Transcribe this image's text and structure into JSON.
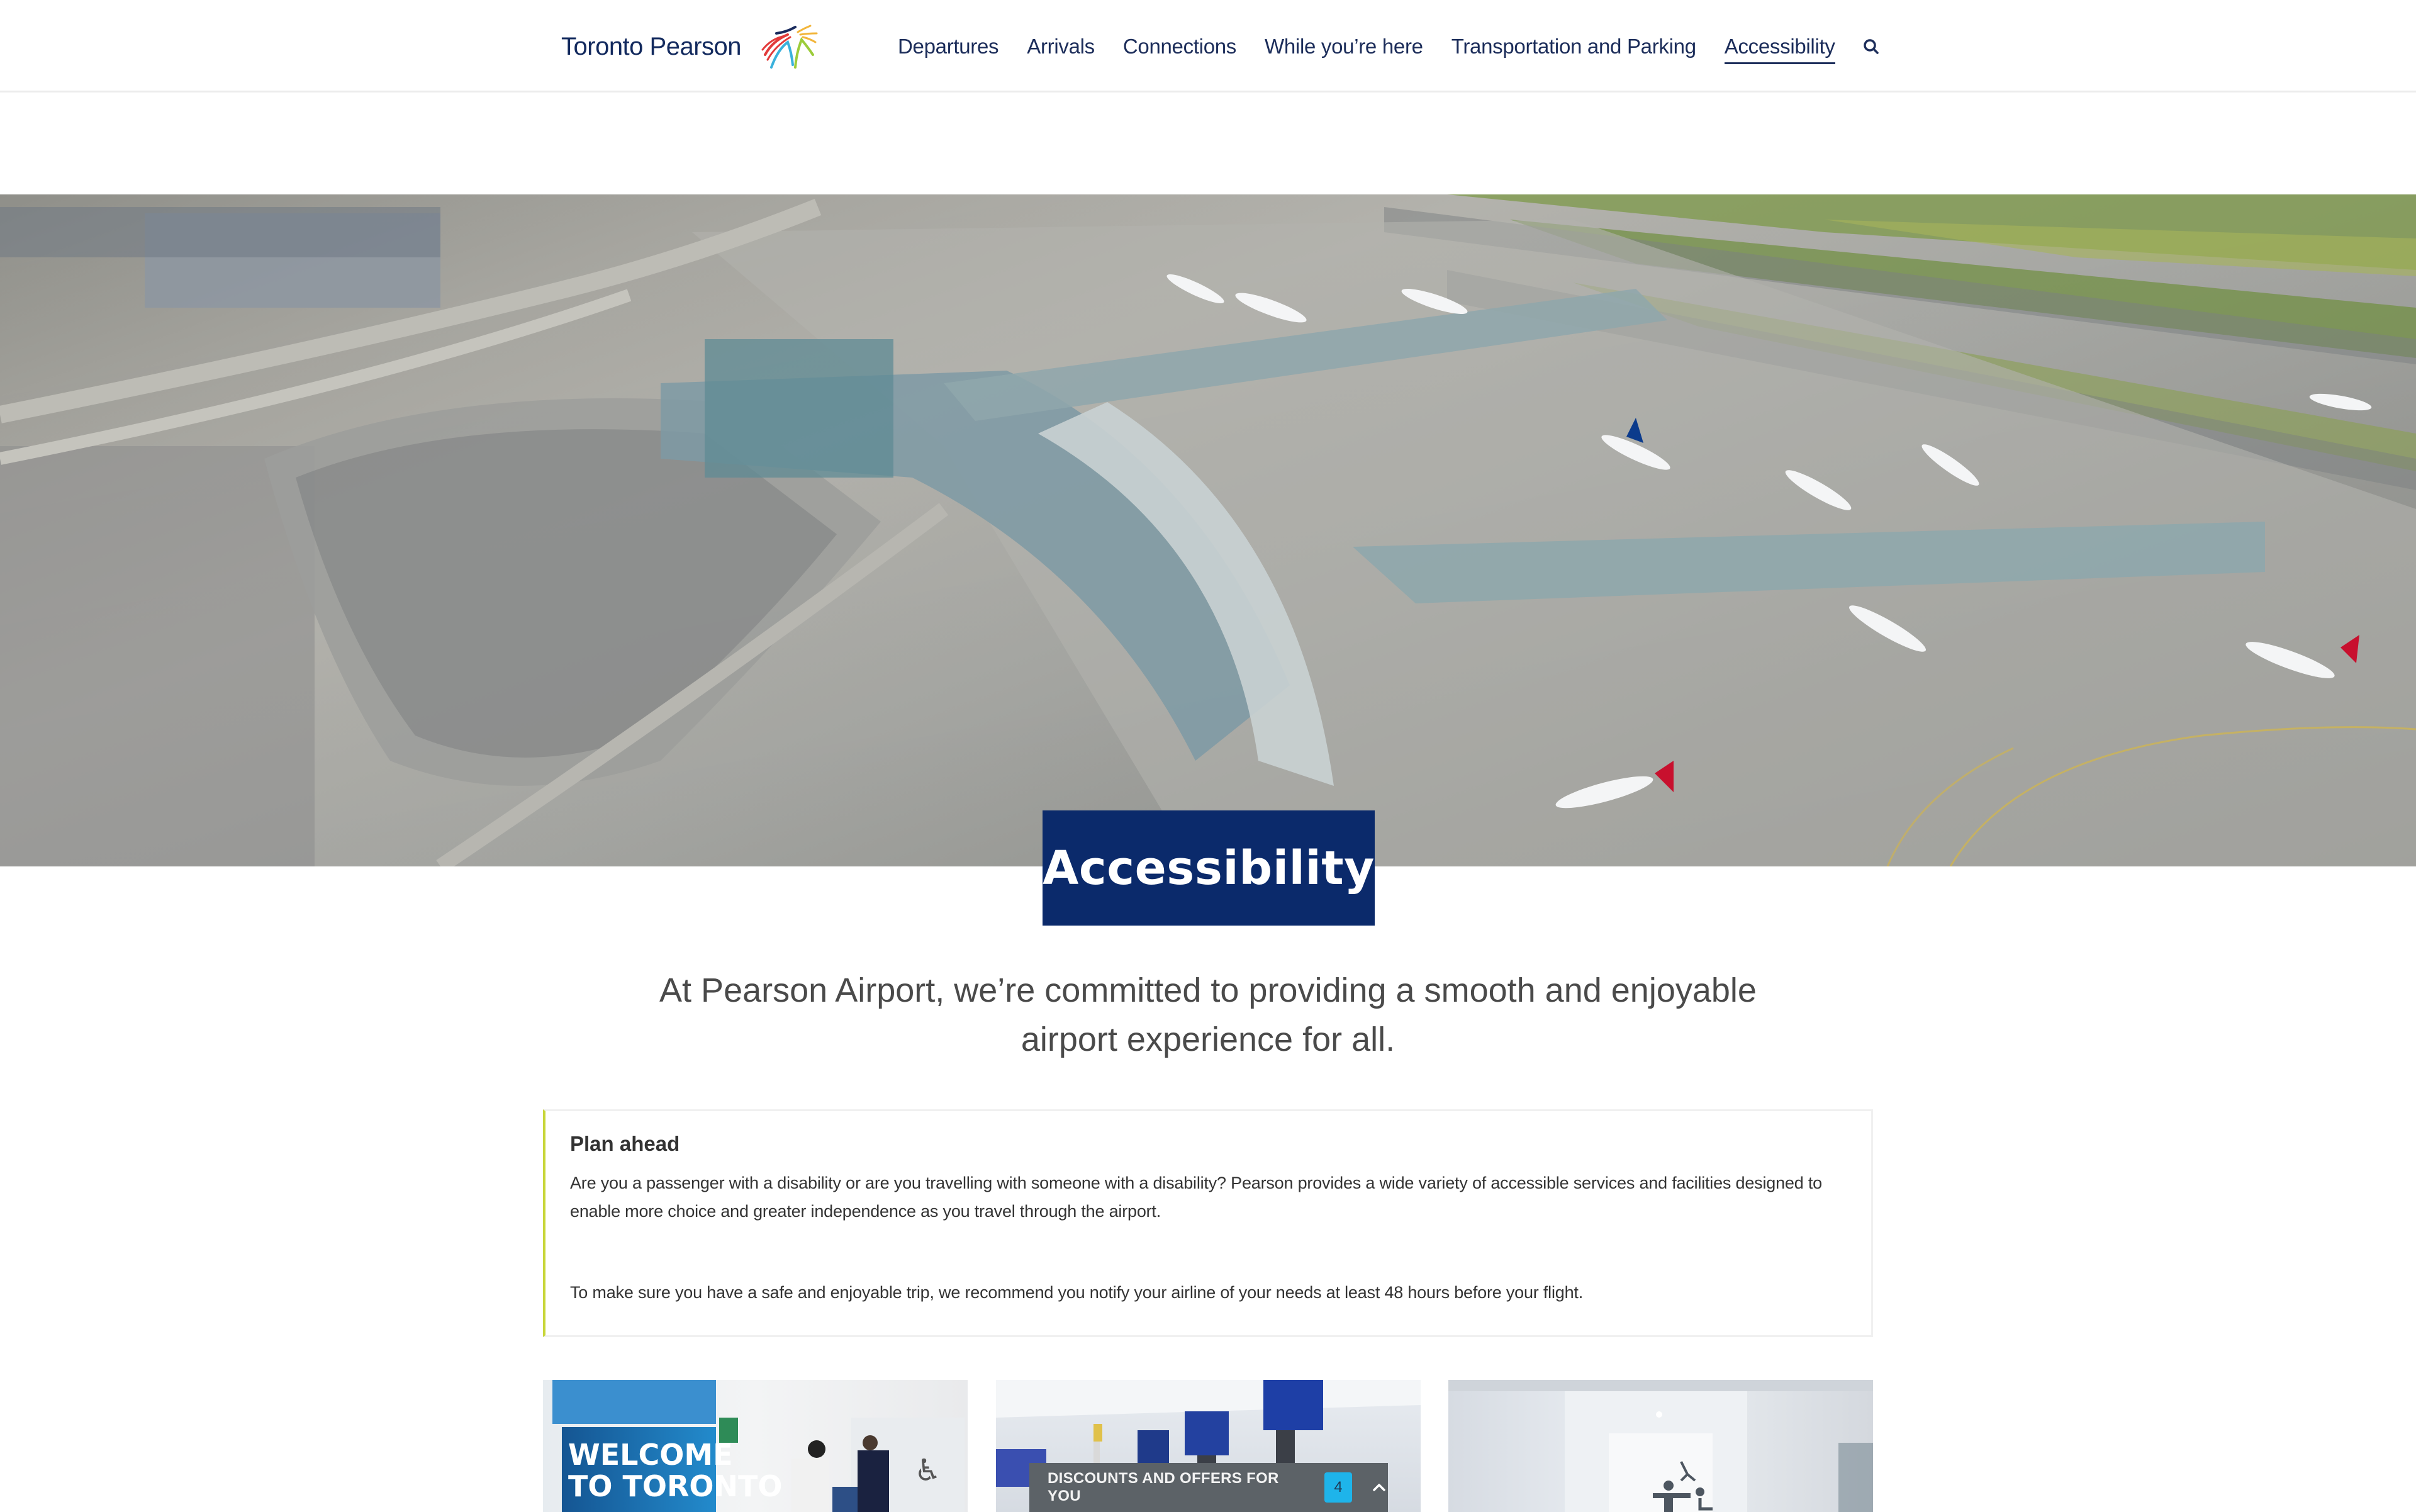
{
  "header": {
    "logo_text": "Toronto Pearson",
    "nav": [
      {
        "label": "Departures",
        "active": false
      },
      {
        "label": "Arrivals",
        "active": false
      },
      {
        "label": "Connections",
        "active": false
      },
      {
        "label": "While you’re here",
        "active": false
      },
      {
        "label": "Transportation and Parking",
        "active": false
      },
      {
        "label": "Accessibility",
        "active": true
      }
    ],
    "search_icon": "search-icon"
  },
  "hero": {
    "image_alt": "Aerial view of Toronto Pearson airport terminal, parking garages and apron with aircraft",
    "title": "Accessibility"
  },
  "intro": {
    "text": "At Pearson Airport, we’re committed to providing a smooth and enjoyable airport experience for all."
  },
  "plan_ahead": {
    "heading": "Plan ahead",
    "paragraph1": "Are you a passenger with a disability or are you travelling with someone with a disability? Pearson provides a wide variety of accessible services and facilities designed to enable more choice and greater independence as you travel through the airport.",
    "paragraph2": "To make sure you have a safe and enjoyable trip, we recommend you notify your airline of your needs at least 48 hours before your flight.",
    "accent_color": "#c8d63a"
  },
  "cards": [
    {
      "image_alt": "Welcome to Toronto sign with staff assisting a passenger in a wheelchair near an accessible washroom",
      "sign_text_line1": "WELCOME",
      "sign_text_line2": "TO TORONTO"
    },
    {
      "image_alt": "Terminal check-in area with overhead information screens"
    },
    {
      "image_alt": "Universal accessible washroom entrance with adult changing table and wheelchair symbols"
    }
  ],
  "offers_bar": {
    "label": "DISCOUNTS AND OFFERS FOR YOU",
    "count": "4",
    "chevron_icon": "chevron-up-icon"
  },
  "colors": {
    "brand_navy": "#0b2a6b",
    "nav_text": "#1c2d5a",
    "badge_blue": "#1eb4ea",
    "offers_bg": "#5c6267"
  }
}
